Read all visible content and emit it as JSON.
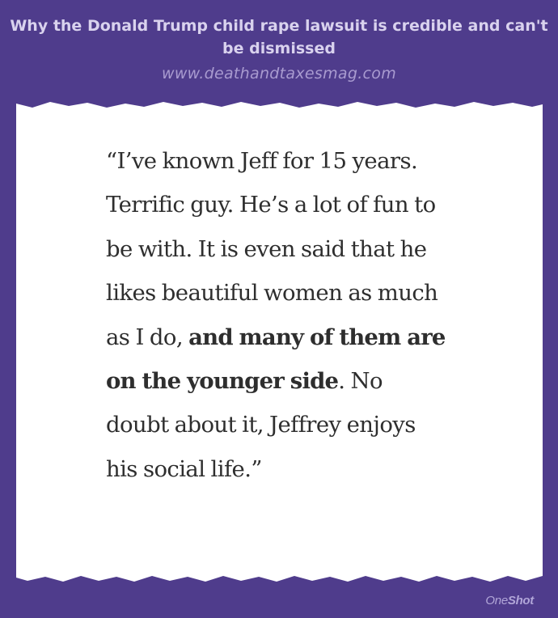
{
  "header": {
    "title": "Why the Donald Trump child rape lawsuit is credible and can't be dismissed",
    "source": "www.deathandtaxesmag.com"
  },
  "quote": {
    "part1": "“I’ve known Jeff for 15 years. Terrific guy. He’s a lot of fun to be with. It is even said that he likes beautiful women as much as I do, ",
    "bold": "and many of them are on the younger side",
    "part2": ". No doubt about it, Jeffrey enjoys his social life.”"
  },
  "brand": {
    "part1": "One",
    "part2": "Shot"
  },
  "colors": {
    "background": "#4f3c8c",
    "paper": "#ffffff",
    "title": "#d9d2ee",
    "source": "#a99bd0",
    "text": "#2e2e2e"
  }
}
